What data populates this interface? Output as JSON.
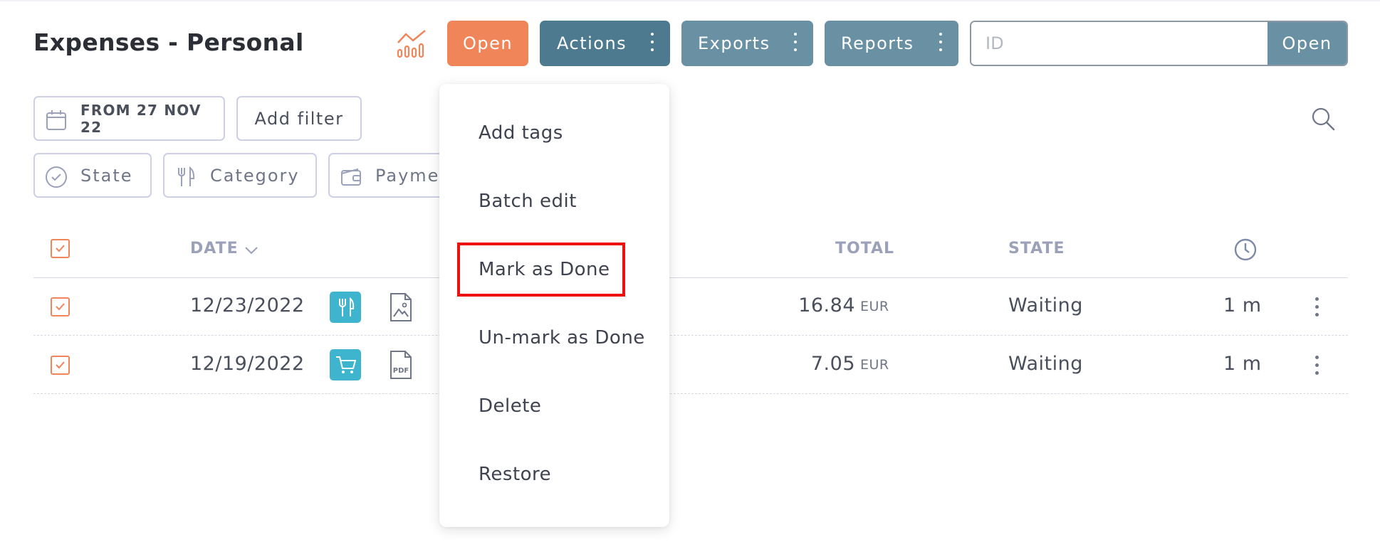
{
  "header": {
    "title": "Expenses - Personal",
    "open_label": "Open",
    "actions_label": "Actions",
    "exports_label": "Exports",
    "reports_label": "Reports",
    "id_placeholder": "ID",
    "id_open_label": "Open"
  },
  "filters": {
    "date_label": "FROM 27 NOV 22",
    "add_filter_label": "Add filter",
    "state_label": "State",
    "category_label": "Category",
    "payment_label": "Payment"
  },
  "table": {
    "columns": {
      "date": "DATE",
      "total": "TOTAL",
      "state": "STATE"
    },
    "rows": [
      {
        "date": "12/23/2022",
        "category_icon": "fork-knife-icon",
        "doc_icon": "image-file-icon",
        "total": "16.84",
        "currency": "EUR",
        "state": "Waiting",
        "age": "1 m"
      },
      {
        "date": "12/19/2022",
        "category_icon": "shopping-cart-icon",
        "doc_icon": "pdf-file-icon",
        "total": "7.05",
        "currency": "EUR",
        "state": "Waiting",
        "age": "1 m"
      }
    ]
  },
  "actions_menu": {
    "items": [
      "Add tags",
      "Batch edit",
      "Mark as Done",
      "Un-mark as Done",
      "Delete",
      "Restore"
    ],
    "highlighted": "Mark as Done"
  },
  "colors": {
    "accent_orange": "#f0855a",
    "actions_blue": "#4d7a8f",
    "secondary_blue": "#6991a3",
    "category_teal": "#3fb4ce",
    "highlight_red": "#ee0f0f"
  }
}
